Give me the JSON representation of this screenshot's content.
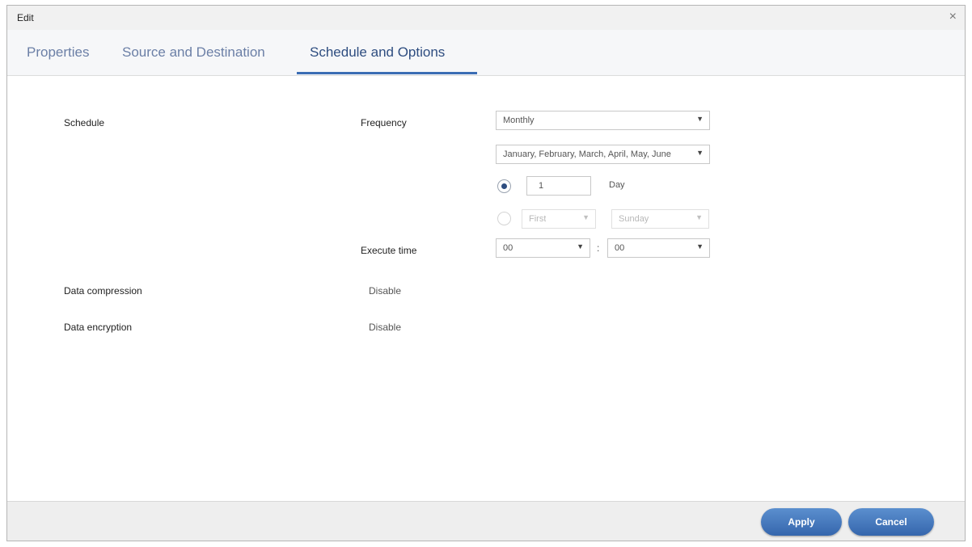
{
  "window": {
    "title": "Edit",
    "close_glyph": "×"
  },
  "tabs": [
    {
      "label": "Properties",
      "active": false
    },
    {
      "label": "Source and Destination",
      "active": false
    },
    {
      "label": "Schedule and Options",
      "active": true
    }
  ],
  "colors": {
    "accent": "#3b6db4",
    "tab_active": "#2e4d80",
    "tab_inactive": "#6b7fa6",
    "button": "#4677bd"
  },
  "schedule": {
    "label": "Schedule",
    "frequency": {
      "label": "Frequency",
      "value": "Monthly",
      "months_value": "January, February, March, April, May, June"
    },
    "day_option": {
      "selected": true,
      "value": "1",
      "unit_label": "Day"
    },
    "weekday_option": {
      "selected": false,
      "ordinal": "First",
      "weekday": "Sunday"
    },
    "execute_time": {
      "label": "Execute time",
      "hour": "00",
      "separator": ":",
      "minute": "00"
    }
  },
  "options": {
    "compression": {
      "label": "Data compression",
      "value": "Disable"
    },
    "encryption": {
      "label": "Data encryption",
      "value": "Disable"
    }
  },
  "footer": {
    "apply_label": "Apply",
    "cancel_label": "Cancel"
  },
  "icons": {
    "dropdown": "chevron-down-icon",
    "close": "close-icon"
  }
}
